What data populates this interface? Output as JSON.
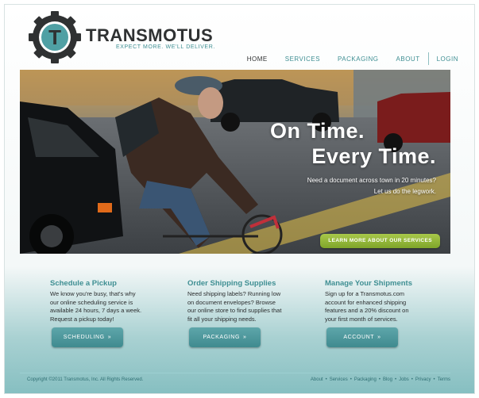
{
  "brand": {
    "name": "TRANSMOTUS",
    "logo_letter": "T",
    "tagline": "EXPECT MORE. WE'LL DELIVER."
  },
  "nav": {
    "items": [
      {
        "label": "HOME",
        "active": true
      },
      {
        "label": "SERVICES",
        "active": false
      },
      {
        "label": "PACKAGING",
        "active": false
      },
      {
        "label": "ABOUT",
        "active": false
      }
    ],
    "login_label": "LOGIN"
  },
  "hero": {
    "title_line1": "On Time.",
    "title_line2": "Every Time.",
    "sub_line1": "Need a document across town in 20 minutes?",
    "sub_line2": "Let us do the legwork.",
    "cta_label": "LEARN MORE ABOUT OUR SERVICES",
    "image": "bicycle-courier-photo"
  },
  "columns": [
    {
      "title": "Schedule a Pickup",
      "lines": [
        "We know you're busy, that's why",
        "our online scheduling service is",
        "available 24 hours, 7 days a week.",
        "Request a pickup today!"
      ],
      "button_label": "SCHEDULING",
      "button_arrow": "»"
    },
    {
      "title": "Order Shipping Supplies",
      "lines": [
        "Need shipping labels? Running low",
        "on document envelopes? Browse",
        "our online store to find supplies that",
        "fit all your shipping needs."
      ],
      "button_label": "PACKAGING",
      "button_arrow": "»"
    },
    {
      "title": "Manage Your Shipments",
      "lines": [
        "Sign up for a Transmotus.com",
        "account for enhanced shipping",
        "features and a 20% discount on",
        "your first month of services."
      ],
      "button_label": "ACCOUNT",
      "button_arrow": "»"
    }
  ],
  "footer": {
    "copyright": "Copyright ©2011 Transmotus, Inc. All Rights Reserved.",
    "links": [
      "About",
      "Services",
      "Packaging",
      "Blog",
      "Jobs",
      "Privacy",
      "Terms"
    ],
    "separator": "•"
  },
  "colors": {
    "accent_teal": "#3f8f93",
    "text_dark": "#2f3132",
    "cta_green": "#8fb43a",
    "button_teal": "#4e989c"
  }
}
